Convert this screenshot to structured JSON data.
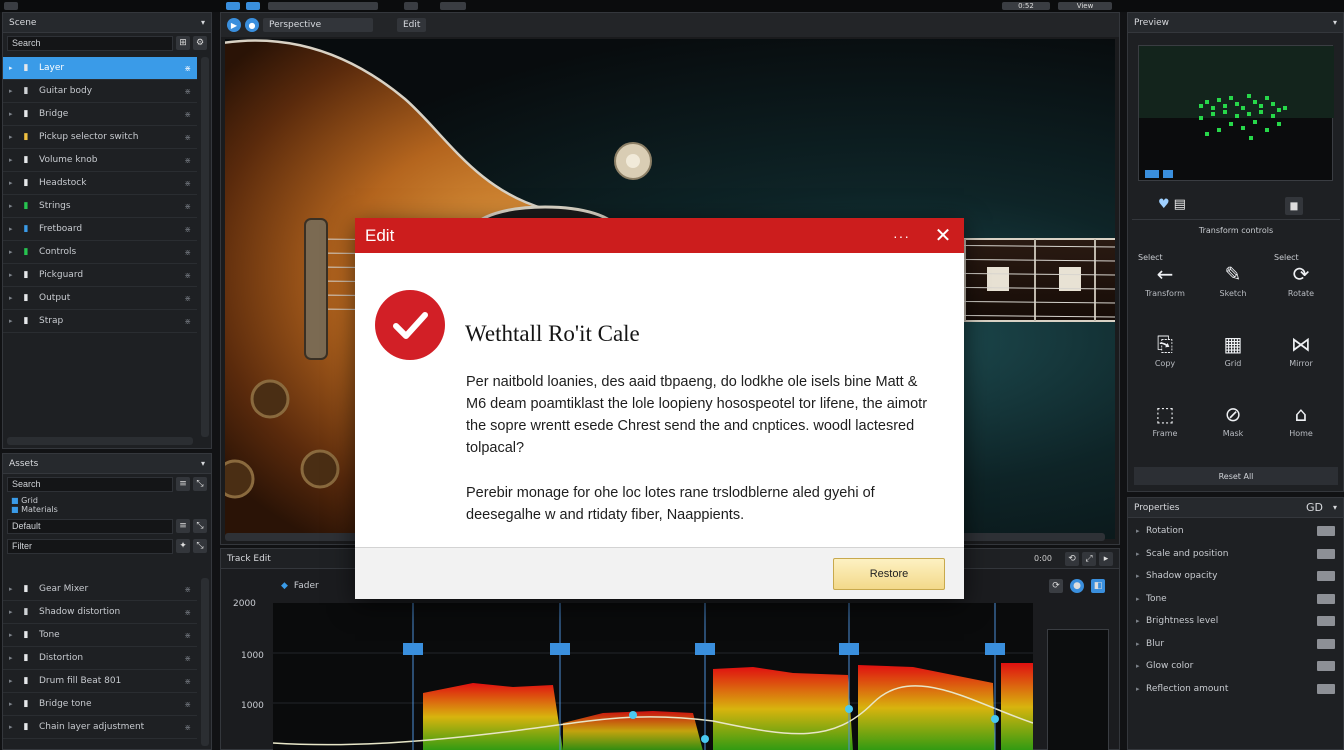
{
  "top_toolbar": {
    "zoom": "0:52",
    "view_button": "View"
  },
  "scene_panel": {
    "title": "Scene",
    "search_value": "Search",
    "items": [
      {
        "label": "Layer",
        "selected": true
      },
      {
        "label": "Guitar body"
      },
      {
        "label": "Bridge"
      },
      {
        "label": "Pickup selector switch"
      },
      {
        "label": "Volume knob"
      },
      {
        "label": "Headstock"
      },
      {
        "label": "Strings"
      },
      {
        "label": "Fretboard"
      },
      {
        "label": "Controls"
      },
      {
        "label": "Pickguard"
      },
      {
        "label": "Output"
      },
      {
        "label": "Strap"
      }
    ]
  },
  "assets_panel": {
    "title": "Assets",
    "search_value": "Search",
    "sub_items": [
      "Grid",
      "Materials"
    ],
    "field_1": "Default",
    "field_2": "Filter",
    "items": [
      {
        "label": "Gear Mixer"
      },
      {
        "label": "Shadow distortion"
      },
      {
        "label": "Tone"
      },
      {
        "label": "Distortion"
      },
      {
        "label": "Drum fill Beat 801"
      },
      {
        "label": "Bridge tone"
      },
      {
        "label": "Chain layer adjustment"
      }
    ]
  },
  "viewport": {
    "tab_label": "Perspective",
    "mode_label": "Edit"
  },
  "modal": {
    "title": "Edit",
    "more": "···",
    "close": "✕",
    "heading": "Wethtall Ro'it Cale",
    "paragraph_1": "Per naitbold loanies, des aaid tbpaeng, do lodkhe ole isels bine Matt & M6 deam poamtiklast the lole loopieny hosospeotel tor lifene, the aimotr the sopre wrentt esede Chrest send the and cnptices. woodl lactesred tolpacal?",
    "paragraph_2": "Perebir monage for ohe loc lotes rane trslodblerne aled gyehi of deesegalhe w and rtidaty fiber, Naappients.",
    "ok_button": "Restore"
  },
  "graph_panel": {
    "title": "Track Edit",
    "time_label": "0:00",
    "track_label": "Fader",
    "y_labels": [
      "2000",
      "1000",
      "1000"
    ]
  },
  "right_panel": {
    "title": "Preview",
    "section_title": "Transform controls",
    "group_left": "Select",
    "group_right": "Select",
    "tools": [
      {
        "icon": "←",
        "label": "Transform",
        "name": "back-arrow-icon"
      },
      {
        "icon": "✎",
        "label": "Sketch",
        "name": "pen-icon"
      },
      {
        "icon": "⟳",
        "label": "Rotate",
        "name": "rotate-icon"
      },
      {
        "icon": "⎘",
        "label": "Copy",
        "name": "copy-icon"
      },
      {
        "icon": "▦",
        "label": "Grid",
        "name": "grid-icon"
      },
      {
        "icon": "⋈",
        "label": "Mirror",
        "name": "mirror-icon"
      },
      {
        "icon": "⬚",
        "label": "Frame",
        "name": "frame-icon"
      },
      {
        "icon": "⊘",
        "label": "Mask",
        "name": "mask-icon"
      },
      {
        "icon": "⌂",
        "label": "Home",
        "name": "home-icon"
      }
    ],
    "footer_button": "Reset All"
  },
  "props_panel": {
    "title": "Properties",
    "header_value": "GD",
    "rows": [
      {
        "label": "Rotation"
      },
      {
        "label": "Scale and position"
      },
      {
        "label": "Shadow opacity"
      },
      {
        "label": "Tone"
      },
      {
        "label": "Brightness level"
      },
      {
        "label": "Blur"
      },
      {
        "label": "Glow color"
      },
      {
        "label": "Reflection amount"
      }
    ]
  },
  "colors": {
    "accent_blue": "#3a9be8",
    "modal_red": "#cc1d1d",
    "check_red": "#d21f26",
    "button_yellow": "#f3d98a"
  }
}
